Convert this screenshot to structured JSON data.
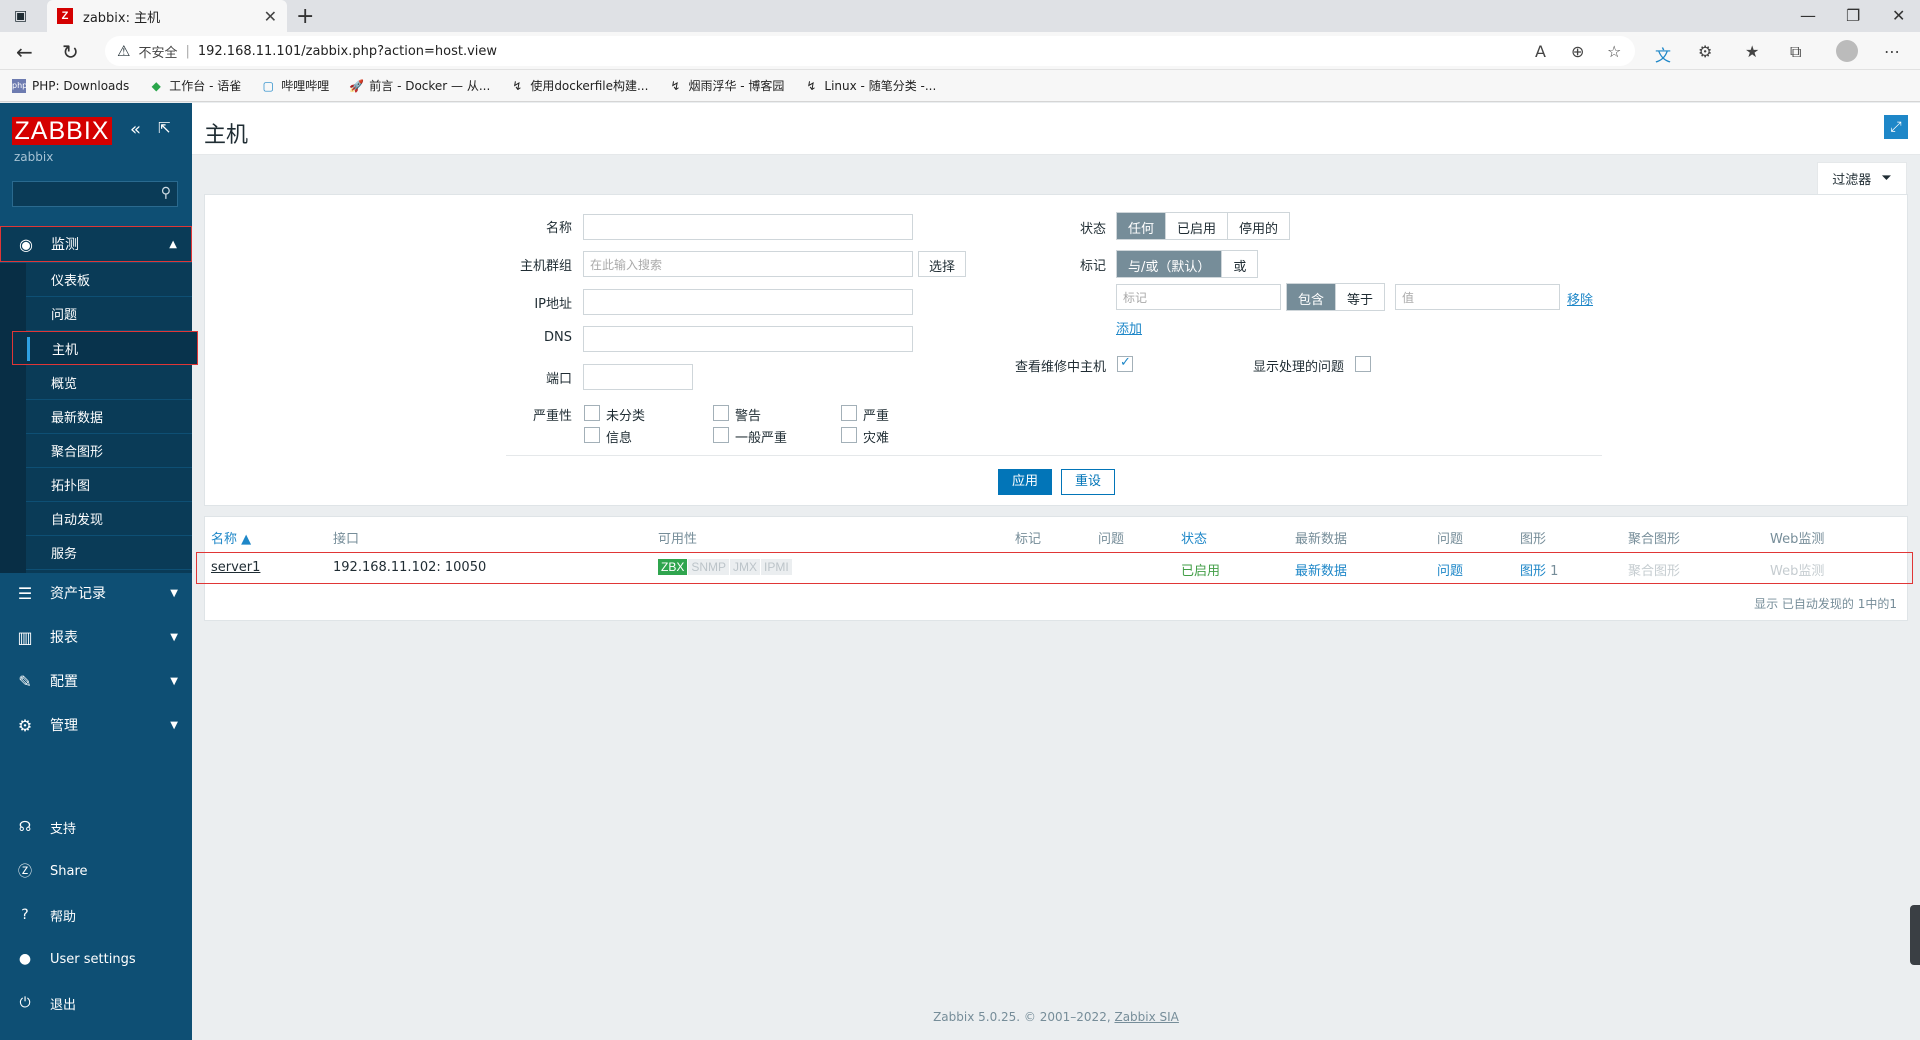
{
  "browser": {
    "tab_title": "zabbix: 主机",
    "tab_favicon": "Z",
    "insecure_label": "不安全",
    "url": "192.168.11.101/zabbix.php?action=host.view",
    "bookmarks": [
      {
        "label": "PHP: Downloads",
        "icon": "php-icon"
      },
      {
        "label": "工作台 - 语雀",
        "icon": "yuque-icon"
      },
      {
        "label": "哔哩哔哩",
        "icon": "bilibili-icon"
      },
      {
        "label": "前言 - Docker — 从...",
        "icon": "rocket-icon"
      },
      {
        "label": "使用dockerfile构建...",
        "icon": "cnblogs-icon"
      },
      {
        "label": "烟雨浮华 - 博客园",
        "icon": "cnblogs-icon"
      },
      {
        "label": "Linux - 随笔分类 -...",
        "icon": "cnblogs-icon"
      }
    ]
  },
  "sidebar": {
    "logo": "ZABBIX",
    "server_name": "zabbix",
    "monitoring": {
      "label": "监测",
      "icon": "eye-icon"
    },
    "submenu": [
      "仪表板",
      "问题",
      "主机",
      "概览",
      "最新数据",
      "聚合图形",
      "拓扑图",
      "自动发现",
      "服务"
    ],
    "active_sub": "主机",
    "sections": [
      {
        "label": "资产记录",
        "icon": "list-icon"
      },
      {
        "label": "报表",
        "icon": "bar-chart-icon"
      },
      {
        "label": "配置",
        "icon": "wrench-icon"
      },
      {
        "label": "管理",
        "icon": "gear-icon"
      }
    ],
    "bottom": [
      {
        "label": "支持",
        "icon": "headset-icon"
      },
      {
        "label": "Share",
        "icon": "share-icon"
      },
      {
        "label": "帮助",
        "icon": "help-icon"
      },
      {
        "label": "User settings",
        "icon": "user-icon"
      },
      {
        "label": "退出",
        "icon": "power-icon"
      }
    ]
  },
  "page": {
    "title": "主机",
    "filter_tab": "过滤器"
  },
  "filter": {
    "name_label": "名称",
    "hostgroup_label": "主机群组",
    "hostgroup_placeholder": "在此输入搜索",
    "select_button": "选择",
    "ip_label": "IP地址",
    "dns_label": "DNS",
    "port_label": "端口",
    "severity_label": "严重性",
    "severities": [
      "未分类",
      "警告",
      "严重",
      "信息",
      "一般严重",
      "灾难"
    ],
    "status_label": "状态",
    "status_options": [
      "任何",
      "已启用",
      "停用的"
    ],
    "status_selected": "任何",
    "tags_label": "标记",
    "tags_operator_options": [
      "与/或（默认）",
      "或"
    ],
    "tag_placeholder": "标记",
    "tag_op_options": [
      "包含",
      "等于"
    ],
    "value_placeholder": "值",
    "remove_link": "移除",
    "add_link": "添加",
    "maintenance_label": "查看维修中主机",
    "maintenance_checked": true,
    "suppressed_label": "显示处理的问题",
    "suppressed_checked": false,
    "apply_button": "应用",
    "reset_button": "重设"
  },
  "table": {
    "headers": [
      "名称 ▲",
      "接口",
      "可用性",
      "标记",
      "问题",
      "状态",
      "最新数据",
      "问题",
      "图形",
      "聚合图形",
      "Web监测"
    ],
    "rows": [
      {
        "name": "server1",
        "interface": "192.168.11.102: 10050",
        "availability": [
          "ZBX",
          "SNMP",
          "JMX",
          "IPMI"
        ],
        "status": "已启用",
        "latest_data": "最新数据",
        "problems": "问题",
        "graphs": "图形",
        "graphs_count": "1",
        "screens": "聚合图形",
        "web": "Web监测"
      }
    ],
    "footer": "显示 已自动发现的 1中的1"
  },
  "footer": {
    "text": "Zabbix 5.0.25. © 2001–2022, ",
    "company": "Zabbix SIA"
  }
}
